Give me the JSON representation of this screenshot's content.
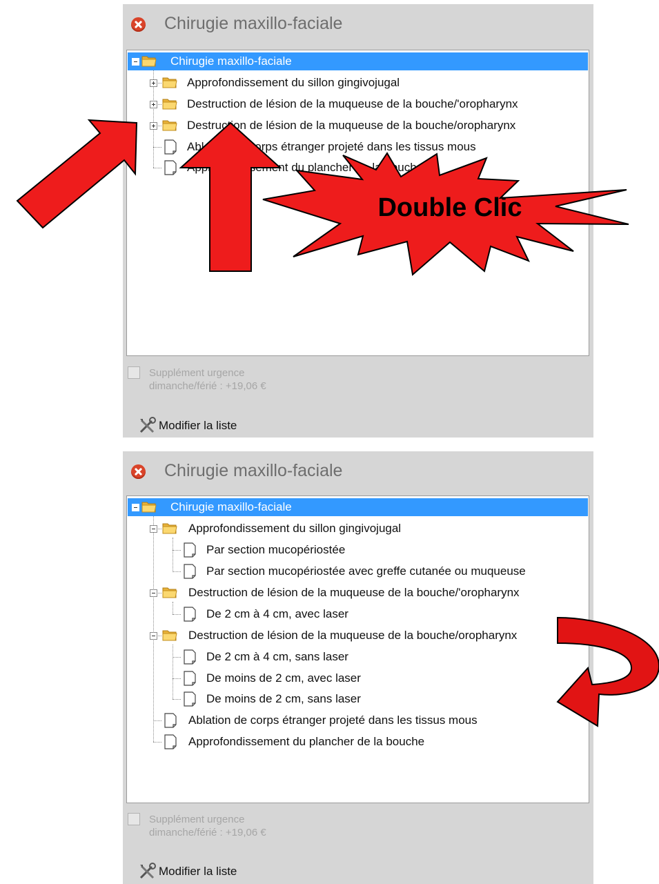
{
  "top_panel": {
    "title": "Chirugie maxillo-faciale",
    "tree": {
      "root": "Chirugie maxillo-faciale",
      "children": [
        "Approfondissement du sillon gingivojugal",
        "Destruction de lésion de la muqueuse de la bouche/'oropharynx",
        "Destruction de lésion de la muqueuse de la bouche/oropharynx",
        "Ablation de corps étranger projeté dans les tissus mous",
        "Approfondissement du plancher de la bouche"
      ]
    },
    "urgence_line1": "Supplément urgence",
    "urgence_line2": "dimanche/férié : +19,06 €",
    "modify_label": "Modifier la liste"
  },
  "callout": {
    "text": "Double Clic"
  },
  "bottom_panel": {
    "title": "Chirugie maxillo-faciale",
    "tree": {
      "root": "Chirugie maxillo-faciale",
      "group1": {
        "label": "Approfondissement du sillon gingivojugal",
        "items": [
          "Par section mucopériostée",
          "Par section mucopériostée avec greffe cutanée ou muqueuse"
        ]
      },
      "group2": {
        "label": "Destruction de lésion de la muqueuse de la bouche/'oropharynx",
        "items": [
          "De 2 cm à 4 cm, avec laser"
        ]
      },
      "group3": {
        "label": "Destruction de lésion de la muqueuse de la bouche/oropharynx",
        "items": [
          "De 2 cm à 4 cm, sans laser",
          "De moins de 2 cm, avec laser",
          "De moins de 2 cm, sans laser"
        ]
      },
      "leaf1": "Ablation de corps étranger projeté dans les tissus mous",
      "leaf2": "Approfondissement du plancher de la bouche"
    },
    "urgence_line1": "Supplément urgence",
    "urgence_line2": "dimanche/férié : +19,06 €",
    "modify_label": "Modifier la liste"
  },
  "colors": {
    "selection": "#3399ff",
    "panel": "#d6d6d6",
    "arrow_red": "#ee1c1c",
    "close_red": "#d9442a"
  }
}
